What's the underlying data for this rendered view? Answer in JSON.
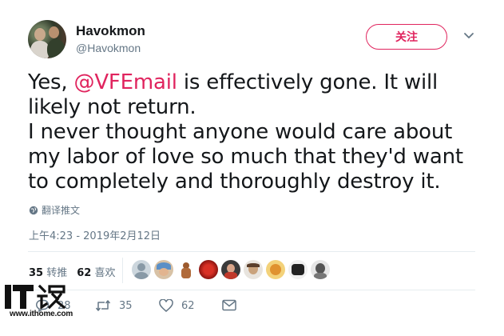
{
  "author": {
    "display_name": "Havokmon",
    "handle": "@Havokmon"
  },
  "follow_label": "关注",
  "tweet": {
    "text_1": "Yes, ",
    "mention": "@VFEmail",
    "text_2": " is effectively gone. It will likely not return.",
    "text_3": "I never thought anyone would care about my labor of love so much that they'd want to completely and thoroughly destroy it."
  },
  "translate_label": "翻译推文",
  "timestamp": "上午4:23 - 2019年2月12日",
  "stats": {
    "retweets_count": "35",
    "retweets_label": "转推",
    "likes_count": "62",
    "likes_label": "喜欢"
  },
  "actions": {
    "reply_count": "28",
    "retweet_count": "35",
    "like_count": "62"
  },
  "watermark": {
    "logo_text": "IT之家",
    "url": "www.ithome.com"
  },
  "colors": {
    "accent": "#e0245e",
    "secondary_text": "#657786",
    "divider": "#e6ecf0"
  }
}
